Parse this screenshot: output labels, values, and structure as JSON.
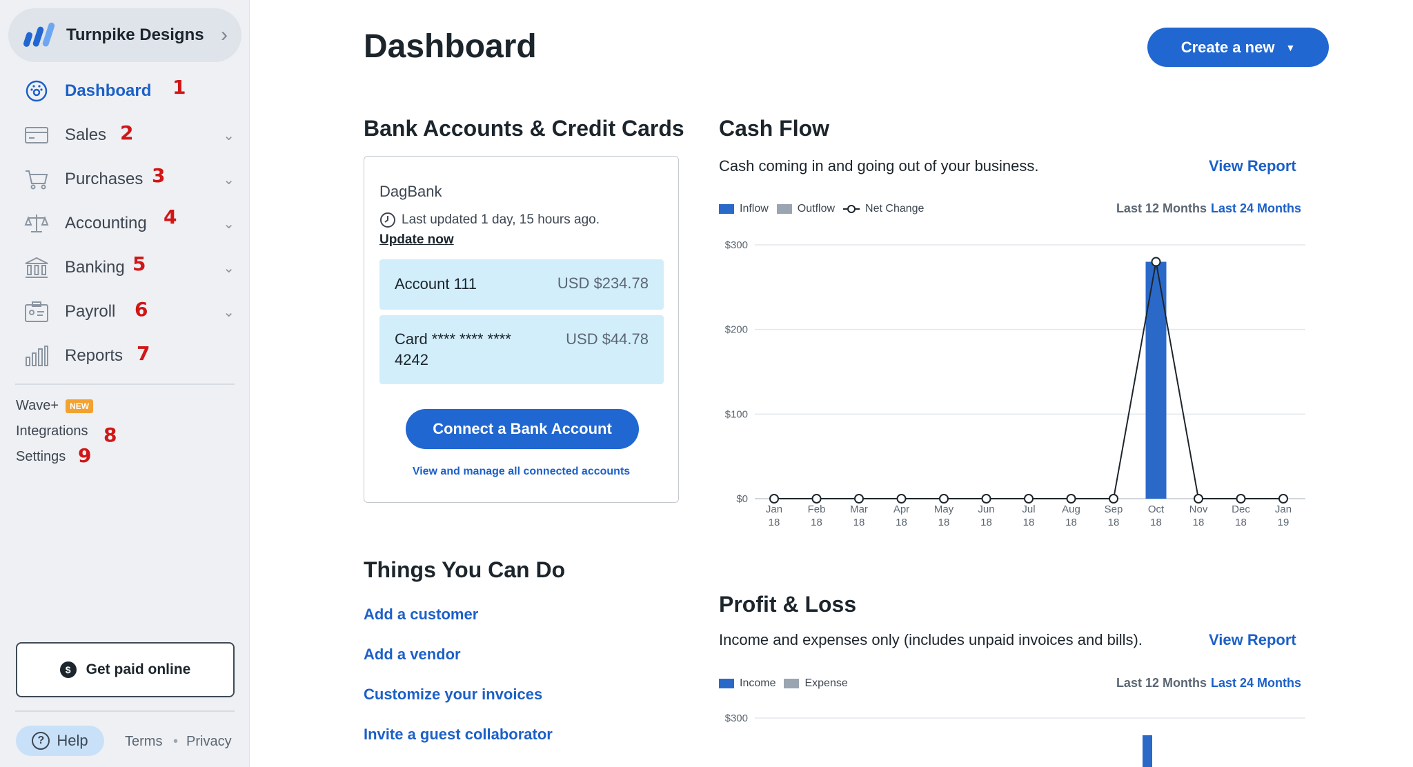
{
  "business": {
    "name": "Turnpike Designs"
  },
  "sidebar": {
    "items": [
      {
        "label": "Dashboard",
        "icon": "dashboard-icon",
        "active": true,
        "marker": "1"
      },
      {
        "label": "Sales",
        "icon": "card-icon",
        "marker": "2"
      },
      {
        "label": "Purchases",
        "icon": "cart-icon",
        "marker": "3"
      },
      {
        "label": "Accounting",
        "icon": "scale-icon",
        "marker": "4"
      },
      {
        "label": "Banking",
        "icon": "bank-icon",
        "marker": "5"
      },
      {
        "label": "Payroll",
        "icon": "payroll-icon",
        "marker": "6"
      },
      {
        "label": "Reports",
        "icon": "bar-chart-icon",
        "marker": "7"
      }
    ],
    "wave_plus": {
      "label": "Wave+",
      "badge": "NEW"
    },
    "integrations": {
      "label": "Integrations",
      "marker": "8"
    },
    "settings": {
      "label": "Settings",
      "marker": "9"
    },
    "get_paid_label": "Get paid online",
    "help_label": "Help",
    "terms_label": "Terms",
    "separator": "•",
    "privacy_label": "Privacy"
  },
  "header": {
    "title": "Dashboard",
    "create_label": "Create a new"
  },
  "bank": {
    "heading": "Bank Accounts & Credit Cards",
    "bank_name": "DagBank",
    "last_updated": "Last updated 1 day, 15 hours ago.",
    "update_now": "Update now",
    "accounts": [
      {
        "name": "Account 111",
        "value": "USD $234.78"
      },
      {
        "name": "Card **** **** **** 4242",
        "value": "USD $44.78"
      }
    ],
    "connect_label": "Connect a Bank Account",
    "manage_label": "View and manage all connected accounts"
  },
  "things": {
    "heading": "Things You Can Do",
    "links": [
      "Add a customer",
      "Add a vendor",
      "Customize your invoices",
      "Invite a guest collaborator"
    ]
  },
  "cashflow": {
    "heading": "Cash Flow",
    "subtitle": "Cash coming in and going out of your business.",
    "view_report": "View Report",
    "legend": [
      "Inflow",
      "Outflow",
      "Net Change"
    ],
    "range_inactive": "Last 12 Months",
    "range_active": "Last 24 Months"
  },
  "profitloss": {
    "heading": "Profit & Loss",
    "subtitle": "Income and expenses only (includes unpaid invoices and bills).",
    "view_report": "View Report",
    "legend": [
      "Income",
      "Expense"
    ],
    "range_inactive": "Last 12 Months",
    "range_active": "Last 24 Months",
    "y_tick": "$300"
  },
  "colors": {
    "accent": "#2167d1",
    "inflow": "#2a69c8",
    "outflow": "#9aa5b1",
    "marker_red": "#d01616"
  },
  "chart_data": [
    {
      "type": "bar",
      "categories": [
        "Jan 18",
        "Feb 18",
        "Mar 18",
        "Apr 18",
        "May 18",
        "Jun 18",
        "Jul 18",
        "Aug 18",
        "Sep 18",
        "Oct 18",
        "Nov 18",
        "Dec 18",
        "Jan 19"
      ],
      "series": [
        {
          "name": "Inflow",
          "values": [
            0,
            0,
            0,
            0,
            0,
            0,
            0,
            0,
            0,
            280,
            0,
            0,
            0
          ]
        },
        {
          "name": "Outflow",
          "values": [
            0,
            0,
            0,
            0,
            0,
            0,
            0,
            0,
            0,
            0,
            0,
            0,
            0
          ]
        },
        {
          "name": "Net Change",
          "values": [
            0,
            0,
            0,
            0,
            0,
            0,
            0,
            0,
            0,
            280,
            0,
            0,
            0
          ]
        }
      ],
      "y_ticks": [
        "$0",
        "$100",
        "$200",
        "$300"
      ],
      "ylim": [
        0,
        300
      ],
      "grid": true,
      "legend": "top-left"
    }
  ]
}
